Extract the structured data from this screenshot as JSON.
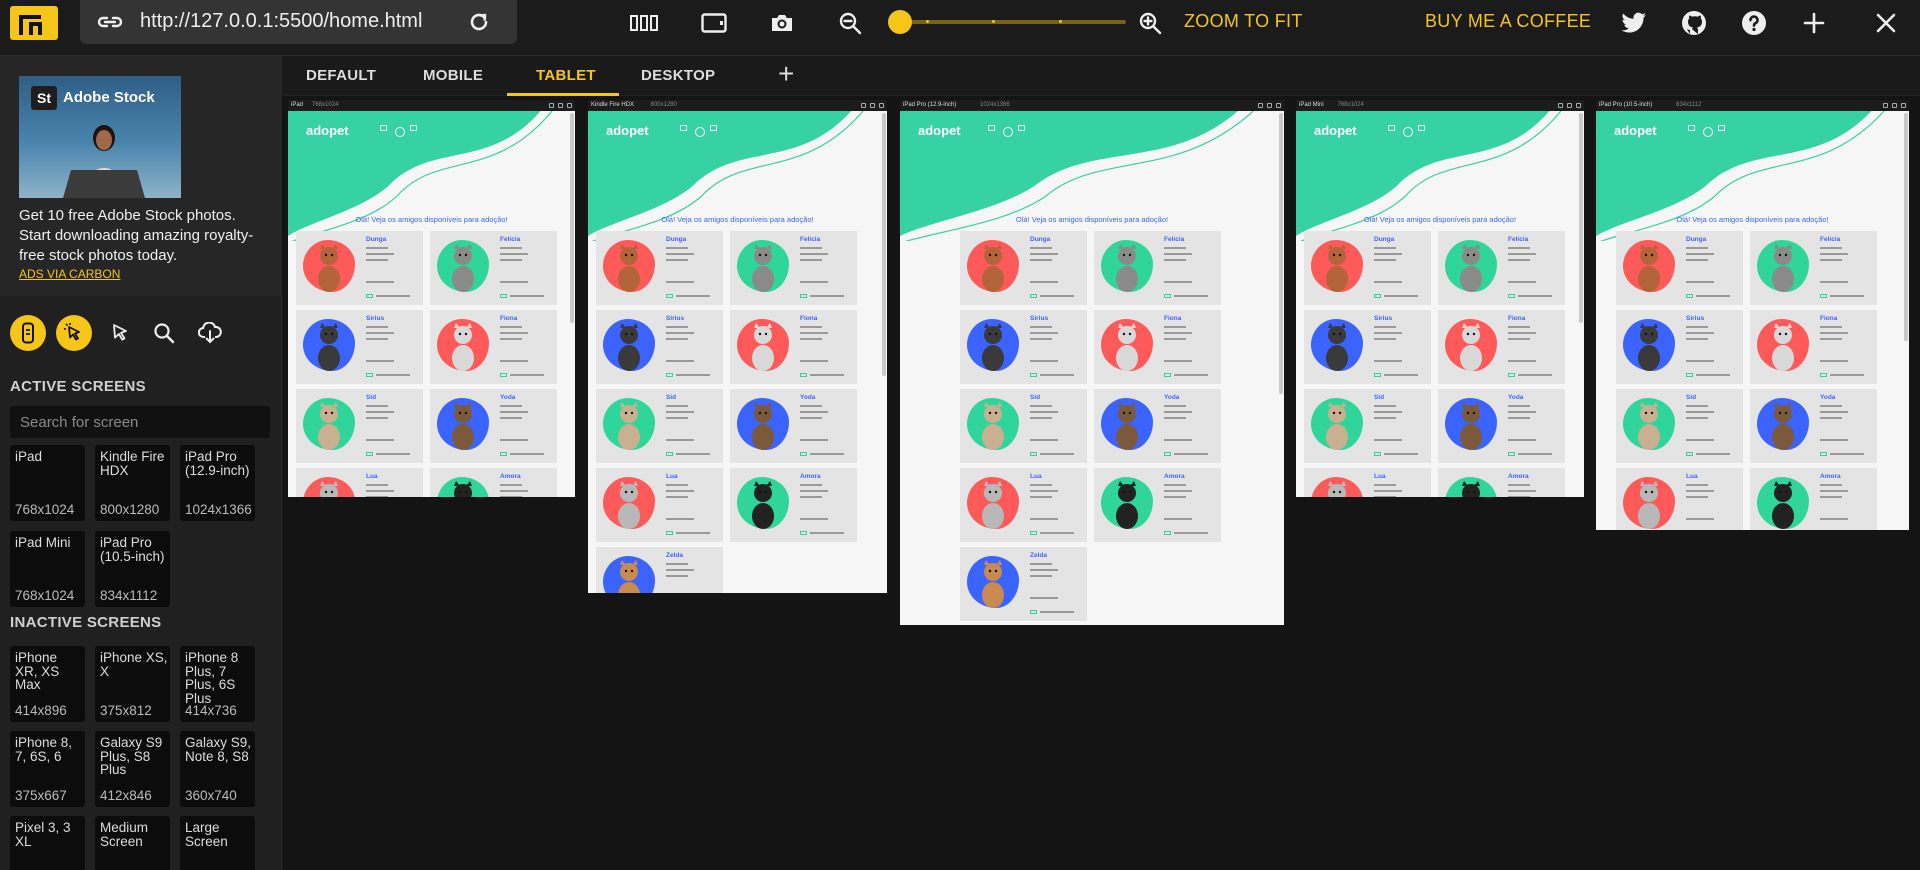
{
  "toolbar": {
    "url": "http://127.0.0.1:5500/home.html",
    "zoom_to_fit": "ZOOM TO FIT",
    "buy_coffee": "BUY ME A COFFEE"
  },
  "ad": {
    "brand": "Adobe Stock",
    "badge": "St",
    "text": "Get 10 free Adobe Stock photos. Start downloading amazing royalty-free stock photos today.",
    "link": "ADS VIA CARBON"
  },
  "sidebar": {
    "active_title": "ACTIVE SCREENS",
    "search_placeholder": "Search for screen",
    "active_screens": [
      {
        "name": "iPad",
        "size": "768x1024"
      },
      {
        "name": "Kindle Fire HDX",
        "size": "800x1280"
      },
      {
        "name": "iPad Pro (12.9-inch)",
        "size": "1024x1366"
      },
      {
        "name": "iPad Mini",
        "size": "768x1024"
      },
      {
        "name": "iPad Pro (10.5-inch)",
        "size": "834x1112"
      }
    ],
    "inactive_title": "INACTIVE SCREENS",
    "inactive_screens": [
      {
        "name": "iPhone XR, XS Max",
        "size": "414x896"
      },
      {
        "name": "iPhone XS, X",
        "size": "375x812"
      },
      {
        "name": "iPhone 8 Plus, 7 Plus, 6S Plus",
        "size": "414x736"
      },
      {
        "name": "iPhone 8, 7, 6S, 6",
        "size": "375x667"
      },
      {
        "name": "Galaxy S9 Plus, S8 Plus",
        "size": "412x846"
      },
      {
        "name": "Galaxy S9, Note 8, S8",
        "size": "360x740"
      },
      {
        "name": "Pixel 3, 3 XL",
        "size": ""
      },
      {
        "name": "Medium Screen",
        "size": ""
      },
      {
        "name": "Large Screen",
        "size": ""
      }
    ]
  },
  "tabs": [
    "DEFAULT",
    "MOBILE",
    "TABLET",
    "DESKTOP"
  ],
  "active_tab": "TABLET",
  "preview": {
    "logo": "adopet",
    "heading": "Olá! Veja os amigos disponíveis para adoção!",
    "devices": [
      {
        "title": "iPad",
        "size": "768x1024"
      },
      {
        "title": "Kindle Fire HDX",
        "size": "800x1280"
      },
      {
        "title": "iPad Pro (12.9-inch)",
        "size": "1024x1366"
      },
      {
        "title": "iPad Mini",
        "size": "768x1024"
      },
      {
        "title": "iPad Pro (10.5-inch)",
        "size": "834x1112"
      }
    ],
    "pets": [
      {
        "name": "Dunga",
        "blob": "#ff5a5a"
      },
      {
        "name": "Felícia",
        "blob": "#2fd59b"
      },
      {
        "name": "Sirius",
        "blob": "#3b63ff"
      },
      {
        "name": "Fiona",
        "blob": "#ff5a5a"
      },
      {
        "name": "Sid",
        "blob": "#2fd59b"
      },
      {
        "name": "Yoda",
        "blob": "#3b63ff"
      },
      {
        "name": "Lua",
        "blob": "#ff5a5a"
      },
      {
        "name": "Amora",
        "blob": "#2fd59b"
      },
      {
        "name": "Zelda",
        "blob": "#3b63ff"
      }
    ]
  },
  "colors": {
    "accent": "#f5c518",
    "teal": "#2fd59b",
    "blue": "#3b63ff",
    "red": "#ff5a5a"
  }
}
